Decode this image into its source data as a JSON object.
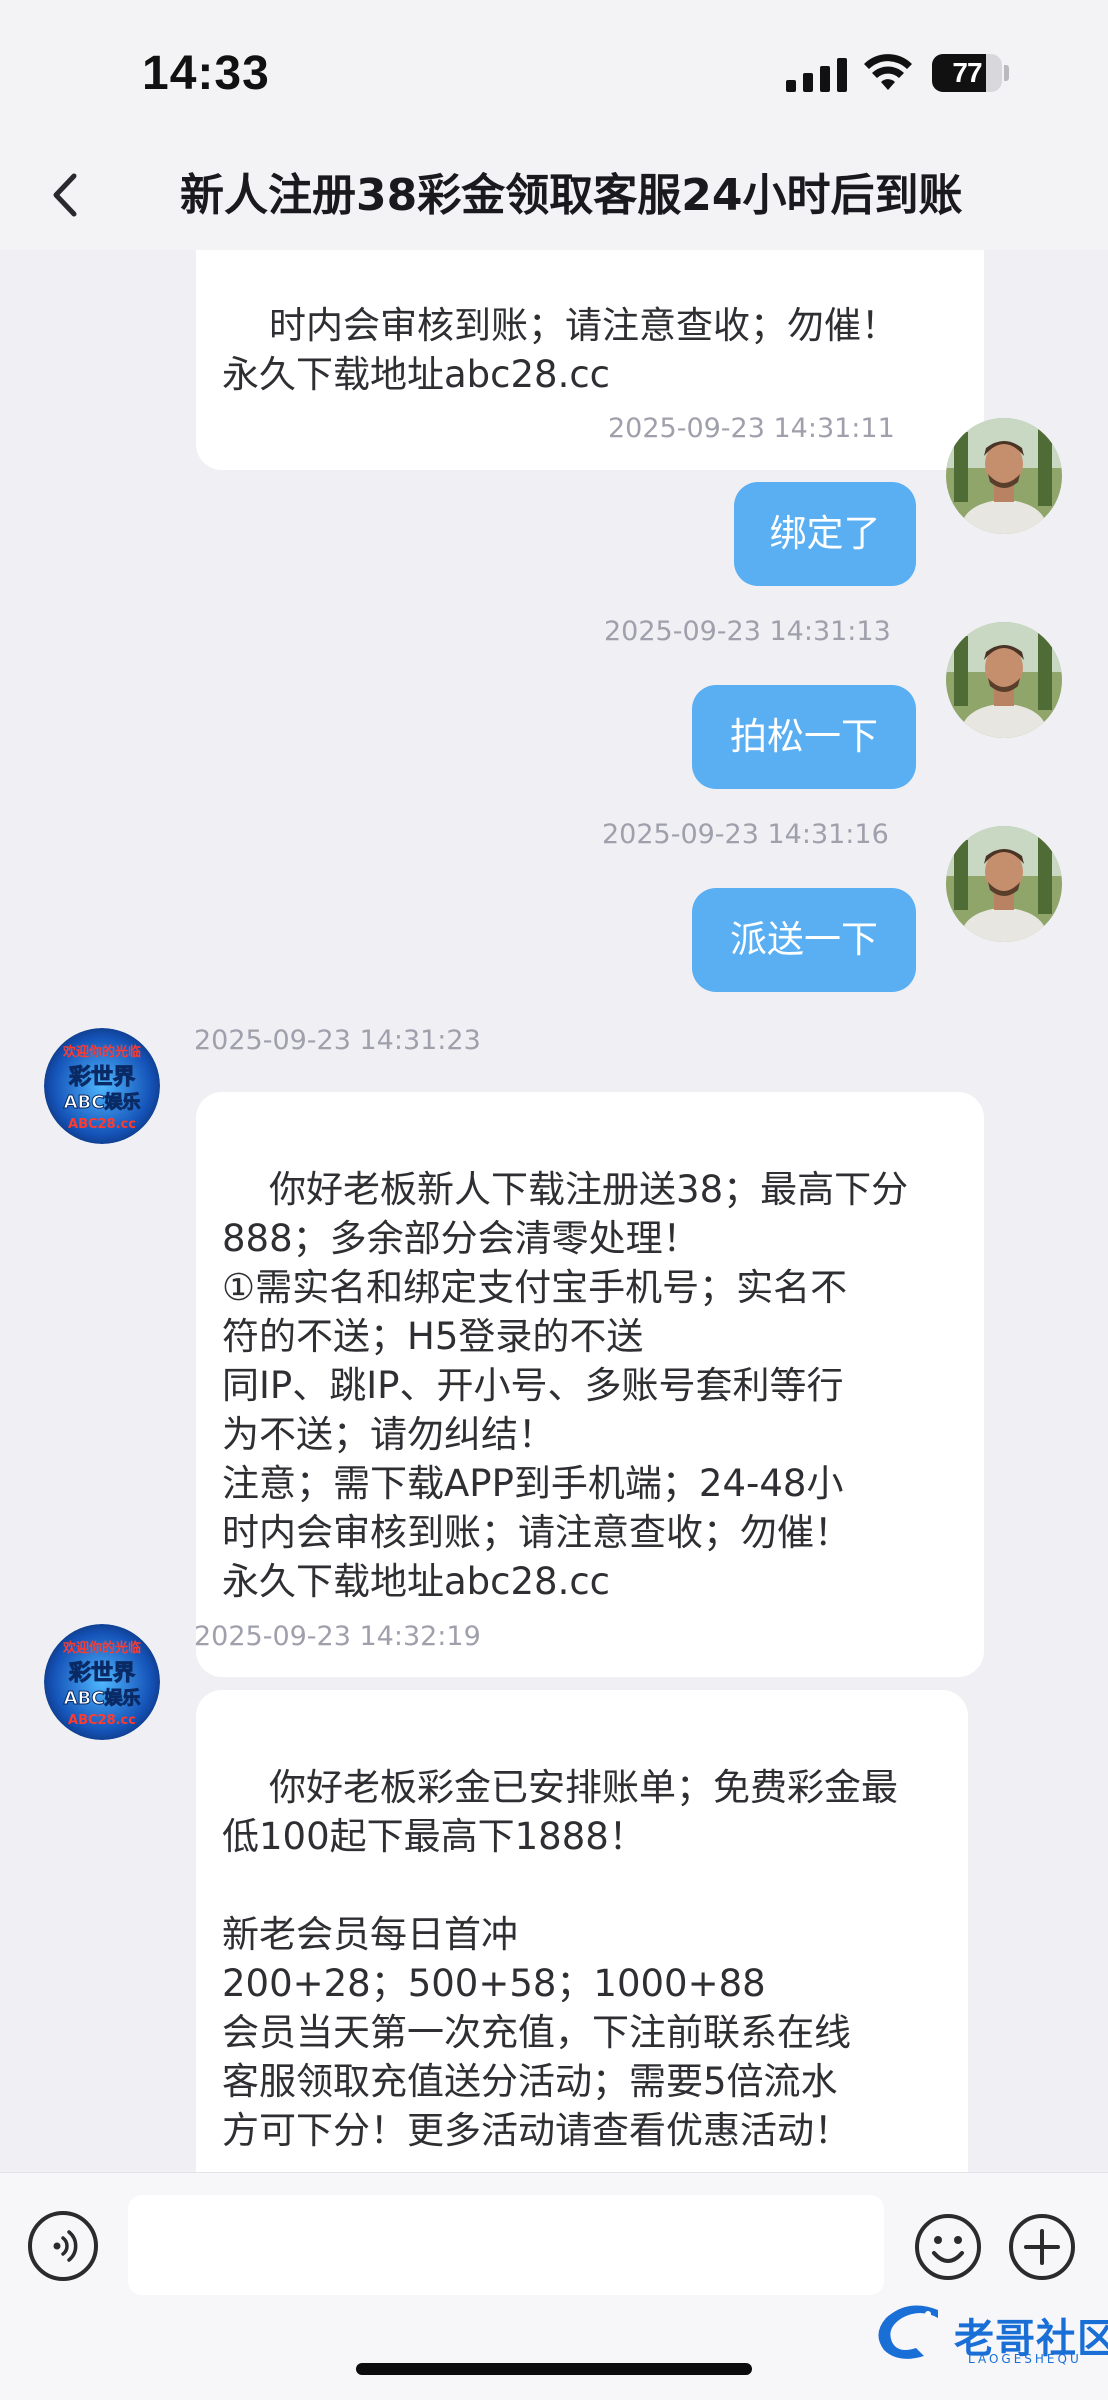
{
  "status_bar": {
    "time": "14:33",
    "battery_level": "77",
    "battery_fraction": 0.77,
    "signal_icon": "cellular-signal-icon",
    "wifi_icon": "wifi-icon"
  },
  "header": {
    "back_icon": "chevron-left-icon",
    "title": "新人注册38彩金领取客服24小时后到账"
  },
  "colors": {
    "outgoing_bubble": "#5aaef2",
    "incoming_bubble": "#ffffff",
    "background": "#f0f0f4",
    "timestamp": "#a0a0ac"
  },
  "messages": [
    {
      "direction": "incoming",
      "text": "时内会审核到账；请注意查收；勿催！\n永久下载地址abc28.cc",
      "partial": true
    },
    {
      "direction": "outgoing",
      "timestamp": "2025-09-23 14:31:11",
      "text": "绑定了"
    },
    {
      "direction": "outgoing",
      "timestamp": "2025-09-23 14:31:13",
      "text": "拍松一下"
    },
    {
      "direction": "outgoing",
      "timestamp": "2025-09-23 14:31:16",
      "text": "派送一下"
    },
    {
      "direction": "incoming",
      "timestamp": "2025-09-23 14:31:23",
      "text": "你好老板新人下载注册送38；最高下分\n888；多余部分会清零处理！\n①需实名和绑定支付宝手机号；实名不\n符的不送；H5登录的不送\n同IP、跳IP、开小号、多账号套利等行\n为不送；请勿纠结！\n注意；需下载APP到手机端；24-48小\n时内会审核到账；请注意查收；勿催！\n永久下载地址abc28.cc"
    },
    {
      "direction": "incoming",
      "timestamp": "2025-09-23 14:32:19",
      "text": "你好老板彩金已安排账单；免费彩金最\n低100起下最高下1888！\n\n新老会员每日首冲\n200+28；500+58；1000+88\n会员当天第一次充值，下注前联系在线\n客服领取充值送分活动；需要5倍流水\n方可下分！更多活动请查看优惠活动！"
    }
  ],
  "agent_avatar": {
    "line1": "彩世界",
    "line2": "ABC娱乐",
    "top_text": "欢迎你的光临",
    "bottom_text": "ABC28.cc"
  },
  "input_bar": {
    "voice_icon": "voice-input-icon",
    "emoji_icon": "emoji-icon",
    "plus_icon": "plus-icon"
  },
  "watermark": {
    "text": "老哥社区",
    "sub": "LAOGESHEQU"
  }
}
